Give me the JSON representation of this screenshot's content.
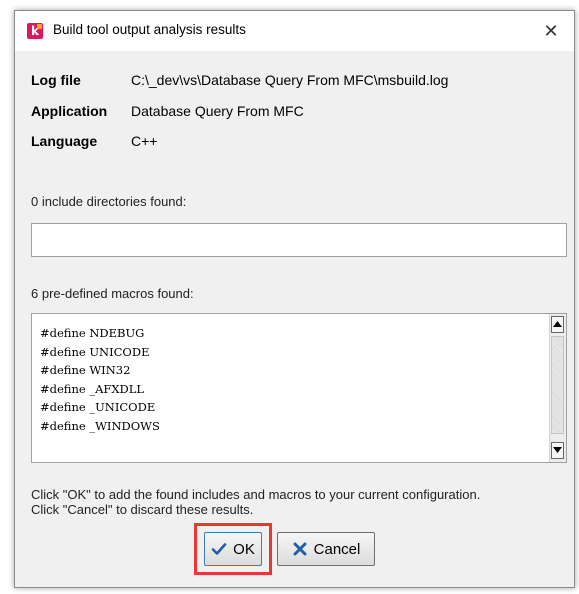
{
  "dialog": {
    "title": "Build tool output analysis results",
    "close_glyph": "✕"
  },
  "info": {
    "log_file_label": "Log file",
    "log_file_value": "C:\\_dev\\vs\\Database Query From MFC\\msbuild.log",
    "application_label": "Application",
    "application_value": "Database Query From MFC",
    "language_label": "Language",
    "language_value": "C++"
  },
  "includes": {
    "label": "0 include directories found:"
  },
  "macros": {
    "label": "6 pre-defined macros found:",
    "items": [
      "#define NDEBUG",
      "#define UNICODE",
      "#define WIN32",
      "#define _AFXDLL",
      "#define _UNICODE",
      "#define _WINDOWS"
    ]
  },
  "hint": {
    "line1": "Click \"OK\" to add the found includes and macros to your current configuration.",
    "line2": "Click \"Cancel\" to discard these results."
  },
  "buttons": {
    "ok_label": "OK",
    "cancel_label": "Cancel"
  },
  "icons": {
    "app": "k-app-icon",
    "ok": "checkmark-icon",
    "cancel": "x-cross-icon"
  },
  "colors": {
    "app_icon": "#d81b60",
    "ok_check": "#1f5fa8",
    "cancel_x": "#1f5fa8",
    "highlight": "#e53935"
  }
}
